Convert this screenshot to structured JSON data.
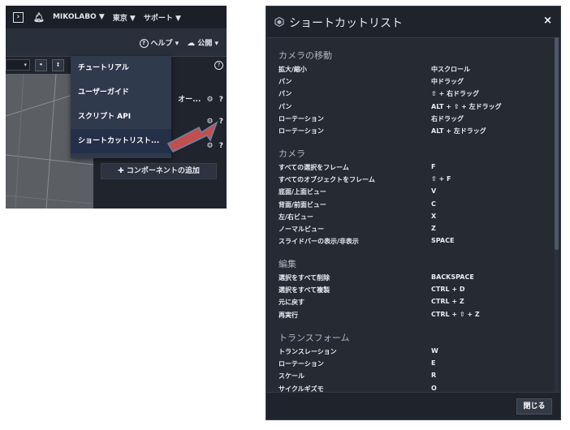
{
  "left_panel": {
    "topbar": {
      "workspace": "MIKOLABO ▼",
      "region": "東京 ▼",
      "support": "サポート ▼"
    },
    "secondbar": {
      "help": "ヘルプ ▾",
      "publish": "公開 ▾"
    },
    "help_menu": {
      "items": [
        "チュートリアル",
        "ユーザーガイド",
        "スクリプト API",
        "ショートカットリスト..."
      ]
    },
    "inspector": {
      "row1_text": "オー...",
      "add_component": "コンポーネントの追加"
    },
    "colors": {
      "arrow": "#c0504d",
      "menu_bg": "#2f3a4d"
    }
  },
  "dialog": {
    "title": "ショートカットリスト",
    "close_icon": "×",
    "close_button": "閉じる",
    "sections": [
      {
        "title": "カメラの移動",
        "items": [
          {
            "name": "拡大/縮小",
            "key": "中スクロール"
          },
          {
            "name": "パン",
            "key": "中ドラッグ"
          },
          {
            "name": "パン",
            "key": "⇧ + 右ドラッグ"
          },
          {
            "name": "パン",
            "key": "ALT + ⇧ + 左ドラッグ"
          },
          {
            "name": "ローテーション",
            "key": "右ドラッグ"
          },
          {
            "name": "ローテーション",
            "key": "ALT + 左ドラッグ"
          }
        ]
      },
      {
        "title": "カメラ",
        "items": [
          {
            "name": "すべての選択をフレーム",
            "key": "F"
          },
          {
            "name": "すべてのオブジェクトをフレーム",
            "key": "⇧ + F"
          },
          {
            "name": "底面/上面ビュー",
            "key": "V"
          },
          {
            "name": "背面/前面ビュー",
            "key": "C"
          },
          {
            "name": "左/右ビュー",
            "key": "X"
          },
          {
            "name": "ノーマルビュー",
            "key": "Z"
          },
          {
            "name": "スライドバーの表示/非表示",
            "key": "SPACE"
          }
        ]
      },
      {
        "title": "編集",
        "items": [
          {
            "name": "選択をすべて削除",
            "key": "BACKSPACE"
          },
          {
            "name": "選択をすべて複製",
            "key": "CTRL + D"
          },
          {
            "name": "元に戻す",
            "key": "CTRL + Z"
          },
          {
            "name": "再実行",
            "key": "CTRL + ⇧ + Z"
          }
        ]
      },
      {
        "title": "トランスフォーム",
        "items": [
          {
            "name": "トランスレーション",
            "key": "W"
          },
          {
            "name": "ローテーション",
            "key": "E"
          },
          {
            "name": "スケール",
            "key": "R"
          },
          {
            "name": "サイクルギズモ",
            "key": "O"
          }
        ]
      }
    ]
  }
}
